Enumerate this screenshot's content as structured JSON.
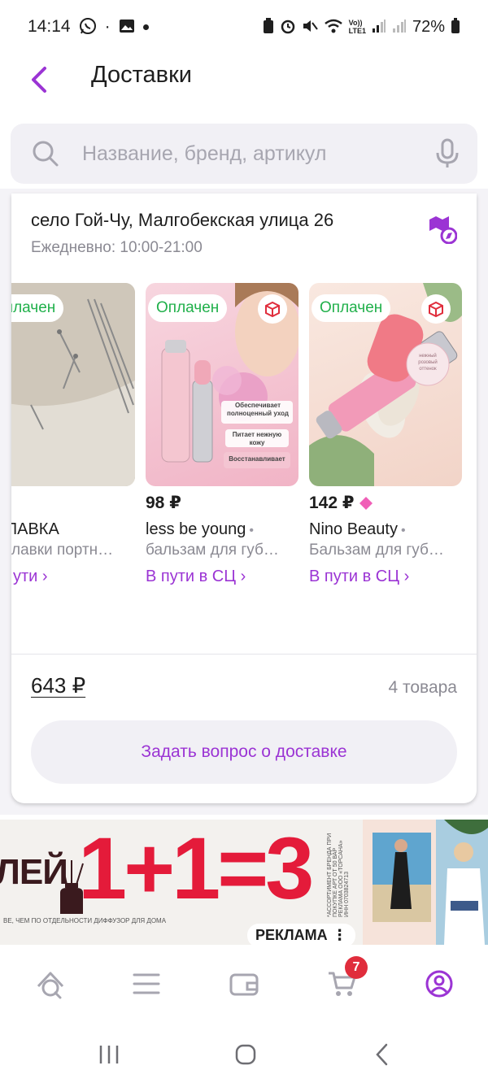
{
  "status_bar": {
    "time": "14:14",
    "dot": "·",
    "network_top": "Vo))",
    "network_bottom": "LTE1",
    "battery": "72%"
  },
  "header": {
    "title": "Доставки"
  },
  "search": {
    "placeholder": "Название, бренд, артикул"
  },
  "delivery": {
    "address": "село Гой-Чу, Малгобекская улица 26",
    "hours": "Ежедневно: 10:00-21:00",
    "products": [
      {
        "badge": "Оплачен",
        "price": "₽",
        "brand": "ЛАВКА",
        "description": "лавки портн…",
        "status": "ути ›",
        "image_text": []
      },
      {
        "badge": "Оплачен",
        "price": "98 ₽",
        "brand": "less be young",
        "description": "бальзам для губ…",
        "status": "В пути в СЦ ›",
        "image_text": [
          "Обеспечивает полноценный уход",
          "Питает нежную кожу",
          "Восстанавливает"
        ]
      },
      {
        "badge": "Оплачен",
        "price": "142 ₽",
        "brand": "Nino Beauty",
        "description": "Бальзам для губ…",
        "status": "В пути в СЦ ›",
        "image_text": [
          "нежный розовый оттенок"
        ]
      }
    ],
    "total": "643 ₽",
    "count": "4 товара",
    "ask_button": "Задать вопрос о доставке"
  },
  "ad": {
    "word": "ЛЕЙ",
    "promo": "1+1=3",
    "fine_print": "ВЕ, ЧЕМ ПО ОТДЕЛЬНОСТИ   ДИФФУЗОР ДЛЯ ДОМА",
    "legal": "*АССОРТИМЕНТ БРЕНДА ПРИ ПОКУПКЕ АРТ ОТ 50 ВАР РЕКЛАМА ООО «ТОРСАНА» ИНН 0703824713",
    "label": "РЕКЛАМА",
    "label_icon": "⋮"
  },
  "tabbar": {
    "cart_count": "7"
  },
  "colors": {
    "accent": "#9b34d4",
    "paid_green": "#21b04b",
    "badge_red": "#e02d3c",
    "promo_red": "#e41b3a"
  }
}
